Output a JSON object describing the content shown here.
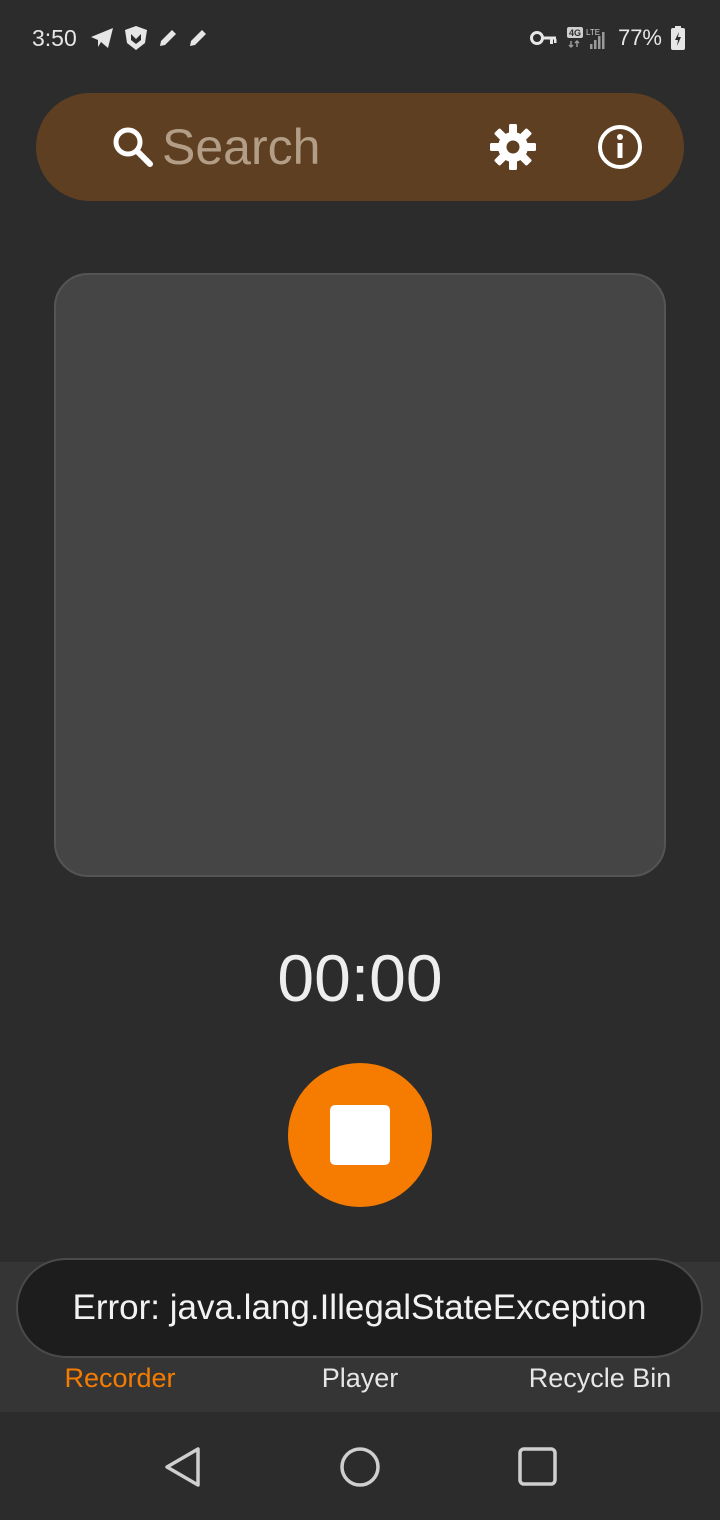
{
  "status_bar": {
    "time": "3:50",
    "battery": "77%",
    "icons_left": [
      "telegram-icon",
      "shield-app-icon",
      "pencil-icon",
      "pencil-icon"
    ],
    "icons_right": [
      "vpn-key-icon",
      "4g-lte-icon",
      "signal-icon",
      "battery-charging-icon"
    ]
  },
  "search_bar": {
    "placeholder": "Search",
    "background_color": "#5f3f22"
  },
  "timer": {
    "value": "00:00"
  },
  "record_control": {
    "state": "recording",
    "accent_color": "#f57c00"
  },
  "bottom_nav": {
    "items": [
      {
        "label": "Recorder",
        "icon": "microphone-icon",
        "active": true
      },
      {
        "label": "Player",
        "icon": "headphones-icon",
        "active": false
      },
      {
        "label": "Recycle Bin",
        "icon": "trash-icon",
        "active": false
      }
    ]
  },
  "snackbar": {
    "message": "Error: java.lang.IllegalStateException"
  }
}
